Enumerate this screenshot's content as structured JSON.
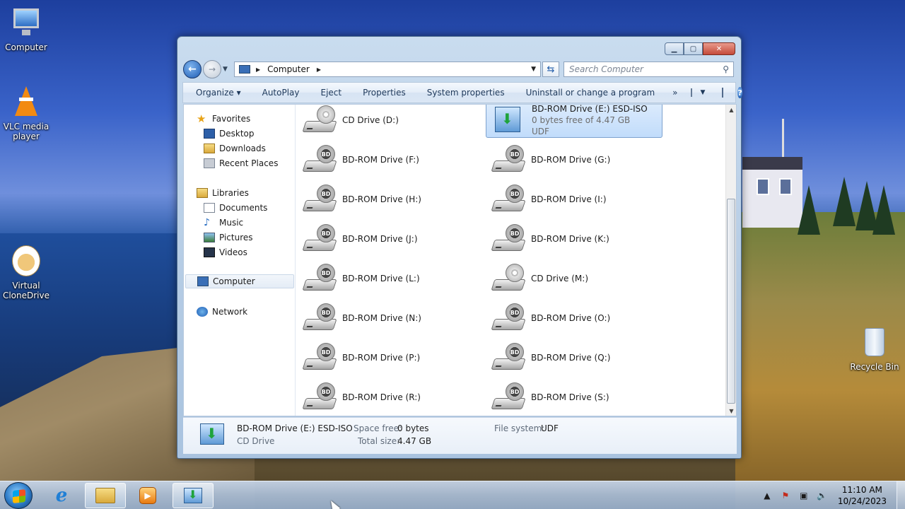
{
  "desktop": {
    "icons": [
      {
        "label": "Computer"
      },
      {
        "label": "VLC media player"
      },
      {
        "label": "Virtual CloneDrive"
      },
      {
        "label": "Recycle Bin"
      }
    ]
  },
  "window": {
    "address": {
      "crumb": "Computer"
    },
    "search": {
      "placeholder": "Search Computer"
    },
    "commands": [
      "Organize",
      "AutoPlay",
      "Eject",
      "Properties",
      "System properties",
      "Uninstall or change a program"
    ],
    "more": "»",
    "nav": {
      "favorites": "Favorites",
      "desktop": "Desktop",
      "downloads": "Downloads",
      "recent": "Recent Places",
      "libraries": "Libraries",
      "documents": "Documents",
      "music": "Music",
      "pictures": "Pictures",
      "videos": "Videos",
      "computer": "Computer",
      "network": "Network"
    },
    "drives": [
      {
        "name": "CD Drive (D:)",
        "kind": "cd"
      },
      {
        "name": "BD-ROM Drive (E:) ESD-ISO",
        "kind": "iso",
        "sub1": "0 bytes free of 4.47 GB",
        "sub2": "UDF",
        "selected": true
      },
      {
        "name": "BD-ROM Drive (F:)",
        "kind": "bd"
      },
      {
        "name": "BD-ROM Drive (G:)",
        "kind": "bd"
      },
      {
        "name": "BD-ROM Drive (H:)",
        "kind": "bd"
      },
      {
        "name": "BD-ROM Drive (I:)",
        "kind": "bd"
      },
      {
        "name": "BD-ROM Drive (J:)",
        "kind": "bd"
      },
      {
        "name": "BD-ROM Drive (K:)",
        "kind": "bd"
      },
      {
        "name": "BD-ROM Drive (L:)",
        "kind": "bd"
      },
      {
        "name": "CD Drive (M:)",
        "kind": "cd"
      },
      {
        "name": "BD-ROM Drive (N:)",
        "kind": "bd"
      },
      {
        "name": "BD-ROM Drive (O:)",
        "kind": "bd"
      },
      {
        "name": "BD-ROM Drive (P:)",
        "kind": "bd"
      },
      {
        "name": "BD-ROM Drive (Q:)",
        "kind": "bd"
      },
      {
        "name": "BD-ROM Drive (R:)",
        "kind": "bd"
      },
      {
        "name": "BD-ROM Drive (S:)",
        "kind": "bd"
      }
    ],
    "details": {
      "name": "BD-ROM Drive (E:) ESD-ISO",
      "type": "CD Drive",
      "space_free_label": "Space free:",
      "space_free": "0 bytes",
      "total_size_label": "Total size:",
      "total_size": "4.47 GB",
      "fs_label": "File system:",
      "fs": "UDF"
    }
  },
  "taskbar": {
    "time": "11:10 AM",
    "date": "10/24/2023"
  },
  "colors": {
    "selection": "#c1dcfb",
    "accent": "#1d5cb4"
  }
}
